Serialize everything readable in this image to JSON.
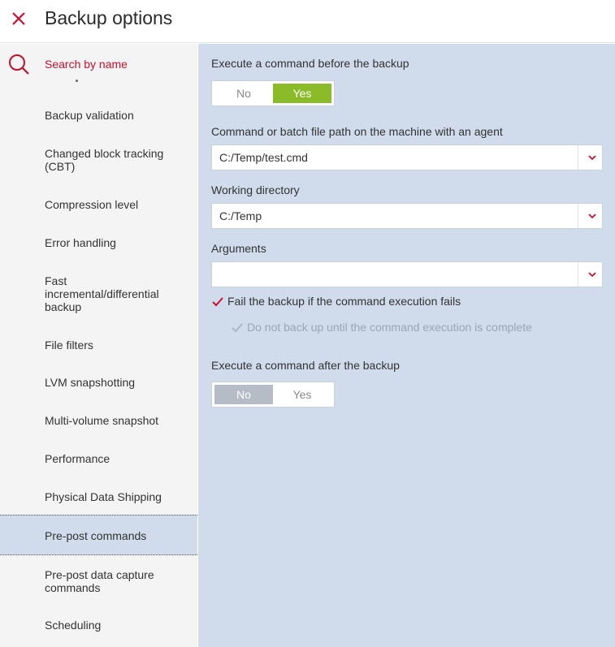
{
  "header": {
    "title": "Backup options"
  },
  "sidebar": {
    "search_placeholder": "Search by name",
    "items": [
      {
        "label": "Backup validation"
      },
      {
        "label": "Changed block tracking (CBT)"
      },
      {
        "label": "Compression level"
      },
      {
        "label": "Error handling"
      },
      {
        "label": "Fast incremental/differential backup"
      },
      {
        "label": "File filters"
      },
      {
        "label": "LVM snapshotting"
      },
      {
        "label": "Multi-volume snapshot"
      },
      {
        "label": "Performance"
      },
      {
        "label": "Physical Data Shipping"
      },
      {
        "label": "Pre-post commands",
        "active": true
      },
      {
        "label": "Pre-post data capture commands"
      },
      {
        "label": "Scheduling"
      }
    ]
  },
  "main": {
    "before": {
      "label": "Execute a command before the backup",
      "no": "No",
      "yes": "Yes",
      "selected": "Yes"
    },
    "command_path": {
      "label": "Command or batch file path on the machine with an agent",
      "value": "C:/Temp/test.cmd"
    },
    "working_dir": {
      "label": "Working directory",
      "value": "C:/Temp"
    },
    "arguments": {
      "label": "Arguments",
      "value": ""
    },
    "fail_backup": {
      "label": "Fail the backup if the command execution fails",
      "checked": true
    },
    "wait_complete": {
      "label": "Do not back up until the command execution is complete",
      "checked": true,
      "disabled": true
    },
    "after": {
      "label": "Execute a command after the backup",
      "no": "No",
      "yes": "Yes",
      "selected": "No"
    }
  },
  "colors": {
    "accent_red": "#c8102e",
    "toggle_yes_green": "#8cbb2a",
    "toggle_no_gray": "#b5bcc5",
    "panel_blue": "#d0dbeb",
    "sidebar_gray": "#f4f4f4"
  }
}
